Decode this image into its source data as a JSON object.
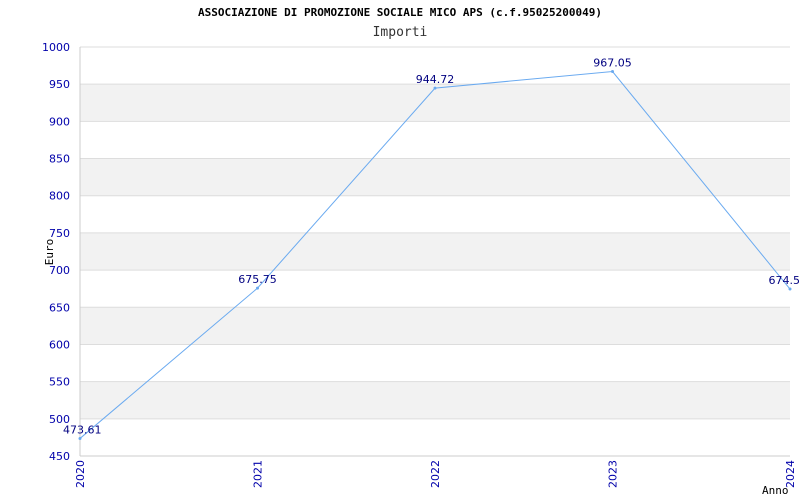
{
  "chart_data": {
    "type": "line",
    "title": "ASSOCIAZIONE DI PROMOZIONE SOCIALE MICO APS (c.f.95025200049)",
    "subtitle": "Importi",
    "xlabel": "Anno",
    "ylabel": "Euro",
    "categories": [
      "2020",
      "2021",
      "2022",
      "2023",
      "2024"
    ],
    "series": [
      {
        "values": [
          473.61,
          675.75,
          944.72,
          967.05,
          674.5
        ],
        "labels": [
          "473.61",
          "675.75",
          "944.72",
          "967.05",
          "674.5"
        ]
      }
    ],
    "ylim": [
      450,
      1000
    ],
    "yticks": [
      "450",
      "500",
      "550",
      "600",
      "650",
      "700",
      "750",
      "800",
      "850",
      "900",
      "950",
      "1000"
    ],
    "grid": true,
    "colors": {
      "line": "#6aaaf0",
      "band": "#f2f2f2",
      "grid": "#dddddd",
      "tick_text": "#0000aa",
      "data_label": "#000080"
    }
  }
}
